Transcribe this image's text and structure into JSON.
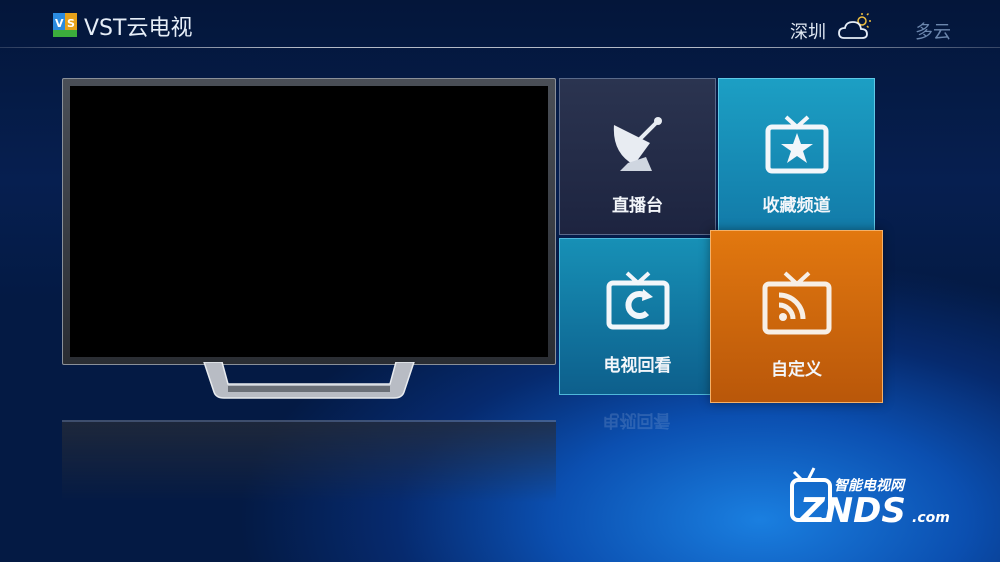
{
  "header": {
    "app_title": "VST云电视",
    "city": "深圳",
    "weather": "多云",
    "logo_letters": "VS"
  },
  "tiles": [
    {
      "id": "live",
      "label": "直播台",
      "icon": "satellite-dish-icon"
    },
    {
      "id": "favorites",
      "label": "收藏频道",
      "icon": "tv-star-icon"
    },
    {
      "id": "replay",
      "label": "电视回看",
      "icon": "tv-replay-icon"
    },
    {
      "id": "custom",
      "label": "自定义",
      "icon": "tv-cast-icon"
    }
  ],
  "watermark": {
    "top_text": "智能电视网",
    "brand": "ZNDS",
    "suffix": ".com"
  },
  "colors": {
    "live_tile": "#2b3450",
    "favorites_tile": "#1c9fc4",
    "replay_tile": "#1790b6",
    "custom_tile": "#e2780f"
  }
}
